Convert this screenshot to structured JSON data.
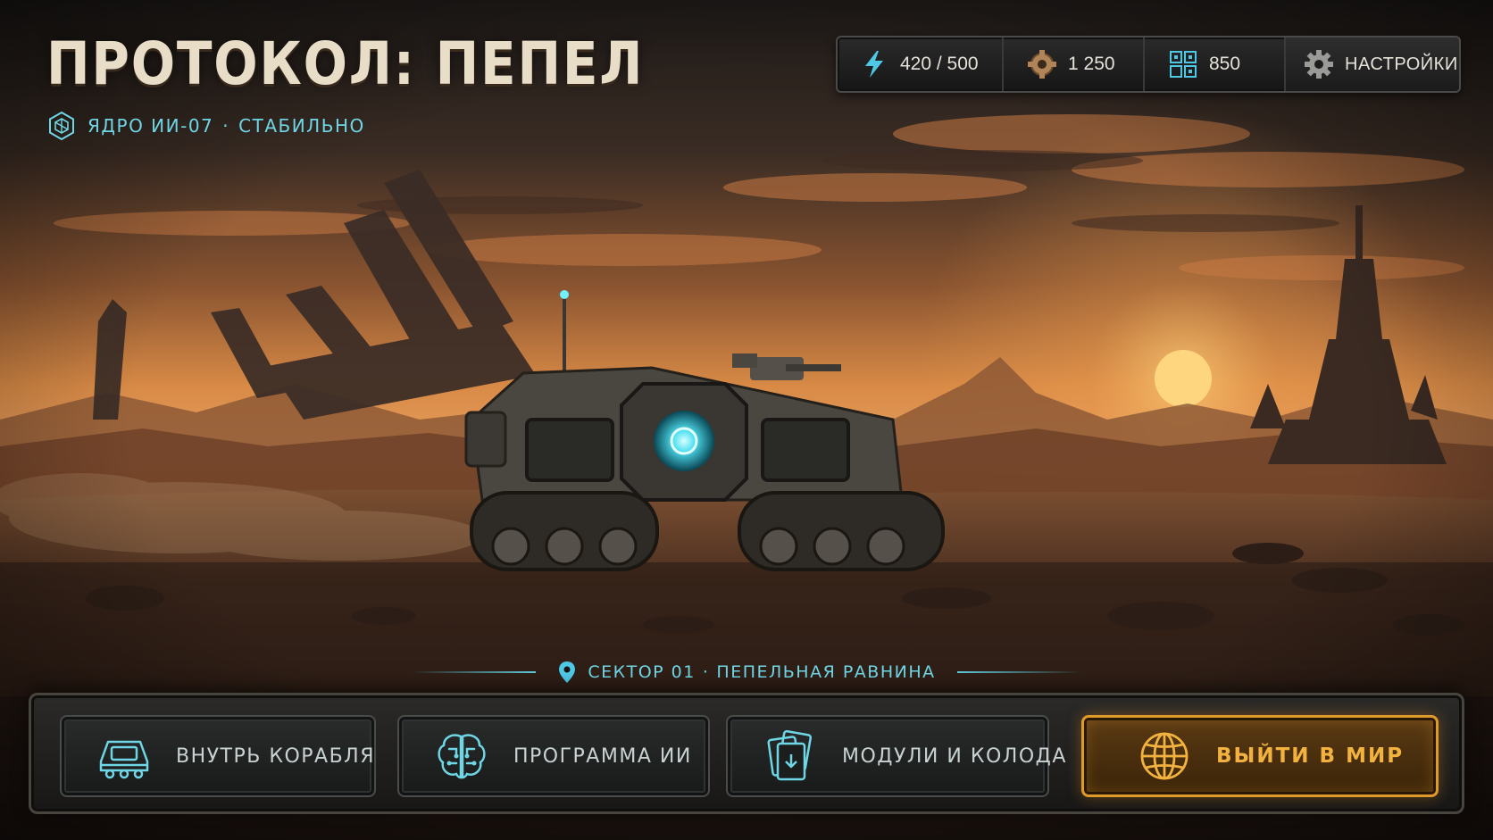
{
  "game": {
    "title": "ПРОТОКОЛ: ПЕПЕЛ",
    "core_name": "ЯДРО ИИ-07",
    "core_sep": "·",
    "core_status": "СТАБИЛЬНО"
  },
  "resources": {
    "energy": {
      "icon": "lightning-icon",
      "value": "420 / 500"
    },
    "scrap": {
      "icon": "gear-scrap-icon",
      "value": "1 250"
    },
    "data": {
      "icon": "data-chip-icon",
      "value": "850"
    }
  },
  "settings": {
    "icon": "gear-icon",
    "label": "НАСТРОЙКИ"
  },
  "sector": {
    "icon": "location-pin-icon",
    "id": "СЕКТОР 01",
    "sep": "·",
    "name": "ПЕПЕЛЬНАЯ РАВНИНА"
  },
  "actions": [
    {
      "icon": "ship-icon",
      "label": "ВНУТРЬ КОРАБЛЯ"
    },
    {
      "icon": "brain-icon",
      "label": "ПРОГРАММА ИИ"
    },
    {
      "icon": "cards-icon",
      "label": "МОДУЛИ И КОЛОДА"
    },
    {
      "icon": "globe-icon",
      "label": "ВЫЙТИ В МИР"
    }
  ],
  "colors": {
    "accent_cyan": "#6fd6e6",
    "accent_orange": "#f2b240",
    "sky_top": "#2b2320",
    "sky_glow": "#d98a3a",
    "ground": "#3a2a1e"
  }
}
